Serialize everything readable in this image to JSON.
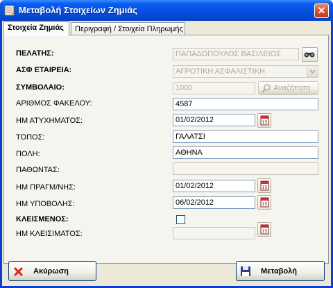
{
  "window": {
    "title": "Μεταβολή Στοιχείων Ζημιάς"
  },
  "tabs": [
    {
      "label": "Στοιχεία Ζημιάς"
    },
    {
      "label": "Περιγραφή / Στοιχεία Πληρωμής"
    }
  ],
  "form": {
    "client": {
      "label": "ΠΕΛΑΤΗΣ:",
      "value": "ΠΑΠΑΔΟΠΟΥΛΟΣ ΒΑΣΙΛΕΙΟΣ"
    },
    "company": {
      "label": "ΑΣΦ ΕΤΑΙΡΕΙΑ:",
      "value": "ΑΓΡΟΤΙΚΗ ΑΣΦΑΛΙΣΤΙΚΗ"
    },
    "contract": {
      "label": "ΣΥΜΒΟΛΑΙΟ:",
      "value": "1000",
      "search_label": "Αναζήτηση"
    },
    "file_no": {
      "label": "ΑΡΙΘΜΟΣ ΦΑΚΕΛΟΥ:",
      "value": "4587"
    },
    "accident_date": {
      "label": "ΗΜ ΑΤΥΧΗΜΑΤΟΣ:",
      "value": "01/02/2012"
    },
    "place": {
      "label": "ΤΟΠΟΣ:",
      "value": "ΓΑΛΑΤΣΙ"
    },
    "city": {
      "label": "ΠΟΛΗ:",
      "value": "ΑΘΗΝΑ"
    },
    "victim": {
      "label": "ΠΑΘΩΝΤΑΣ:",
      "value": ""
    },
    "exam_date": {
      "label": "ΗΜ ΠΡΑΓΜ/ΝΗΣ:",
      "value": "01/02/2012"
    },
    "submit_date": {
      "label": "ΗΜ ΥΠΟΒΟΛΗΣ:",
      "value": "06/02/2012"
    },
    "closed": {
      "label": "ΚΛΕΙΣΜΕΝΟΣ:",
      "checked": false
    },
    "close_date": {
      "label": "ΗΜ ΚΛΕΙΣΙΜΑΤΟΣ:",
      "value": ""
    }
  },
  "buttons": {
    "cancel": "Ακύρωση",
    "save": "Μεταβολή",
    "calendar_text": "15"
  },
  "colors": {
    "titlebar": "#0550e2",
    "active_tab_accent": "#ff9a18",
    "cancel_icon": "#d42020",
    "save_icon": "#2c3f8f"
  }
}
